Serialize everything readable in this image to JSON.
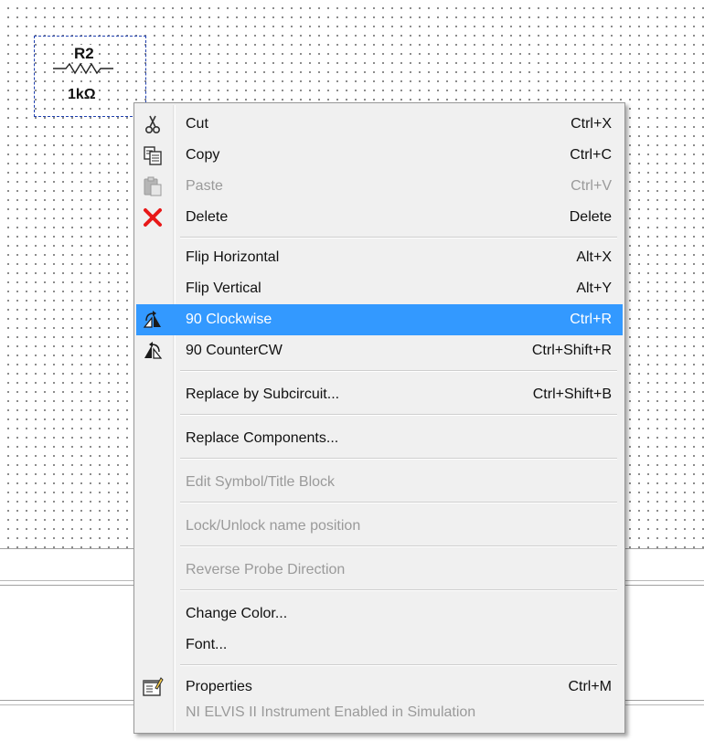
{
  "component": {
    "ref": "R2",
    "value": "1kΩ"
  },
  "menu": {
    "items": [
      {
        "label": "Cut",
        "shortcut": "Ctrl+X",
        "icon": "scissors-icon",
        "enabled": true
      },
      {
        "label": "Copy",
        "shortcut": "Ctrl+C",
        "icon": "copy-icon",
        "enabled": true
      },
      {
        "label": "Paste",
        "shortcut": "Ctrl+V",
        "icon": "paste-icon",
        "enabled": false
      },
      {
        "label": "Delete",
        "shortcut": "Delete",
        "icon": "delete-x-icon",
        "enabled": true
      },
      {
        "label": "Flip Horizontal",
        "shortcut": "Alt+X",
        "enabled": true
      },
      {
        "label": "Flip Vertical",
        "shortcut": "Alt+Y",
        "enabled": true
      },
      {
        "label": "90 Clockwise",
        "shortcut": "Ctrl+R",
        "icon": "rotate-clockwise-icon",
        "enabled": true,
        "highlighted": true
      },
      {
        "label": "90 CounterCW",
        "shortcut": "Ctrl+Shift+R",
        "icon": "rotate-counterclockwise-icon",
        "enabled": true
      },
      {
        "label": "Replace by Subcircuit...",
        "shortcut": "Ctrl+Shift+B",
        "enabled": true
      },
      {
        "label": "Replace Components...",
        "shortcut": "",
        "enabled": true
      },
      {
        "label": "Edit Symbol/Title Block",
        "shortcut": "",
        "enabled": false
      },
      {
        "label": "Lock/Unlock name position",
        "shortcut": "",
        "enabled": false
      },
      {
        "label": "Reverse Probe Direction",
        "shortcut": "",
        "enabled": false
      },
      {
        "label": "Change Color...",
        "shortcut": "",
        "enabled": true
      },
      {
        "label": "Font...",
        "shortcut": "",
        "enabled": true
      },
      {
        "label": "Properties",
        "shortcut": "Ctrl+M",
        "icon": "properties-icon",
        "enabled": true
      },
      {
        "label": "NI ELVIS II Instrument Enabled in Simulation",
        "shortcut": "",
        "enabled": false
      }
    ]
  },
  "colors": {
    "highlight": "#3399ff",
    "disabled_text": "#9a9a9a",
    "delete_icon": "#e81818",
    "selection_border": "#2040b0"
  }
}
